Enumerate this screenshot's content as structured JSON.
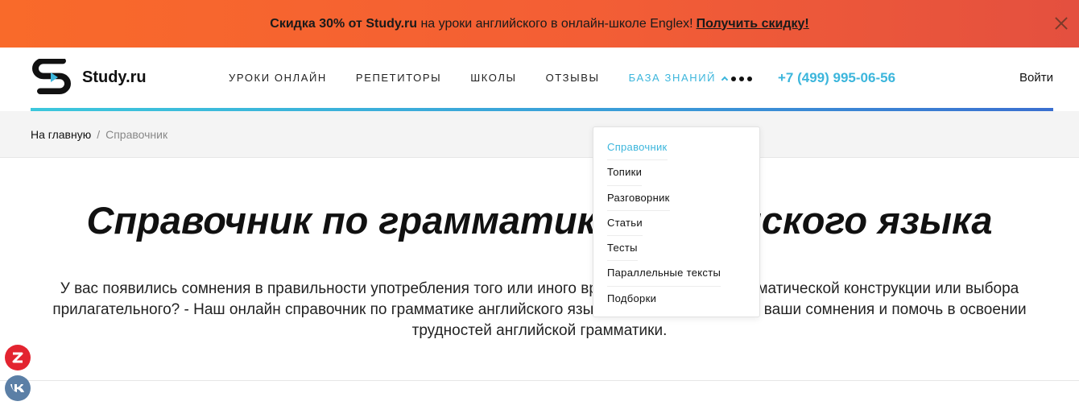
{
  "promo": {
    "bold_start": "Скидка 30% от Study.ru",
    "text": " на уроки английского в онлайн-школе Englex!",
    "link": "Получить скидку!"
  },
  "header": {
    "brand": "Study.ru",
    "nav": [
      {
        "label": "Уроки онлайн"
      },
      {
        "label": "Репетиторы"
      },
      {
        "label": "Школы"
      },
      {
        "label": "Отзывы"
      },
      {
        "label": "База знаний"
      }
    ],
    "phone": "+7 (499) 995-06-56",
    "login": "Войти"
  },
  "breadcrumbs": {
    "home": "На главную",
    "separator": "/",
    "current": "Справочник"
  },
  "main": {
    "title": "Справочник по грамматике английского языка",
    "intro": "У вас появились сомнения в правильности употребления того или иного времени, предлога, грамматической конструкции или выбора прилагательного? - Наш онлайн справочник по грамматике английского языка поможет решить все ваши сомнения и помочь в освоении трудностей английской грамматики."
  },
  "dropdown": {
    "items": [
      {
        "label": "Справочник"
      },
      {
        "label": "Топики"
      },
      {
        "label": "Разговорник"
      },
      {
        "label": "Статьи"
      },
      {
        "label": "Тесты"
      },
      {
        "label": "Параллельные тексты"
      },
      {
        "label": "Подборки"
      }
    ]
  },
  "colors": {
    "accent": "#3cb6dc",
    "promo_bg": "#f35e35",
    "zen": "#e32430",
    "vk": "#5b7fa6"
  },
  "icons": [
    "close-icon",
    "study-logo-icon",
    "chevron-up-icon",
    "more-icon",
    "zen-icon",
    "vk-icon"
  ]
}
